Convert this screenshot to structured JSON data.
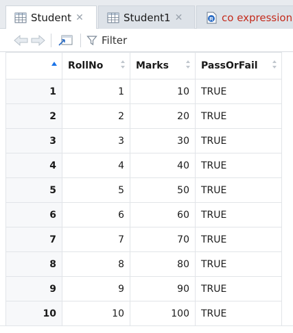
{
  "tabs": [
    {
      "label": "Student",
      "active": true
    },
    {
      "label": "Student1",
      "active": false
    },
    {
      "label": "co expression",
      "active": false
    }
  ],
  "toolbar": {
    "filter_label": "Filter"
  },
  "table": {
    "columns": [
      "RollNo",
      "Marks",
      "PassOrFail"
    ],
    "rows": [
      {
        "row": "1",
        "RollNo": "1",
        "Marks": "10",
        "PassOrFail": "TRUE"
      },
      {
        "row": "2",
        "RollNo": "2",
        "Marks": "20",
        "PassOrFail": "TRUE"
      },
      {
        "row": "3",
        "RollNo": "3",
        "Marks": "30",
        "PassOrFail": "TRUE"
      },
      {
        "row": "4",
        "RollNo": "4",
        "Marks": "40",
        "PassOrFail": "TRUE"
      },
      {
        "row": "5",
        "RollNo": "5",
        "Marks": "50",
        "PassOrFail": "TRUE"
      },
      {
        "row": "6",
        "RollNo": "6",
        "Marks": "60",
        "PassOrFail": "TRUE"
      },
      {
        "row": "7",
        "RollNo": "7",
        "Marks": "70",
        "PassOrFail": "TRUE"
      },
      {
        "row": "8",
        "RollNo": "8",
        "Marks": "80",
        "PassOrFail": "TRUE"
      },
      {
        "row": "9",
        "RollNo": "9",
        "Marks": "90",
        "PassOrFail": "TRUE"
      },
      {
        "row": "10",
        "RollNo": "10",
        "Marks": "100",
        "PassOrFail": "TRUE"
      }
    ]
  },
  "colors": {
    "accent": "#1a73e8",
    "error_tab": "#c42b1c"
  }
}
